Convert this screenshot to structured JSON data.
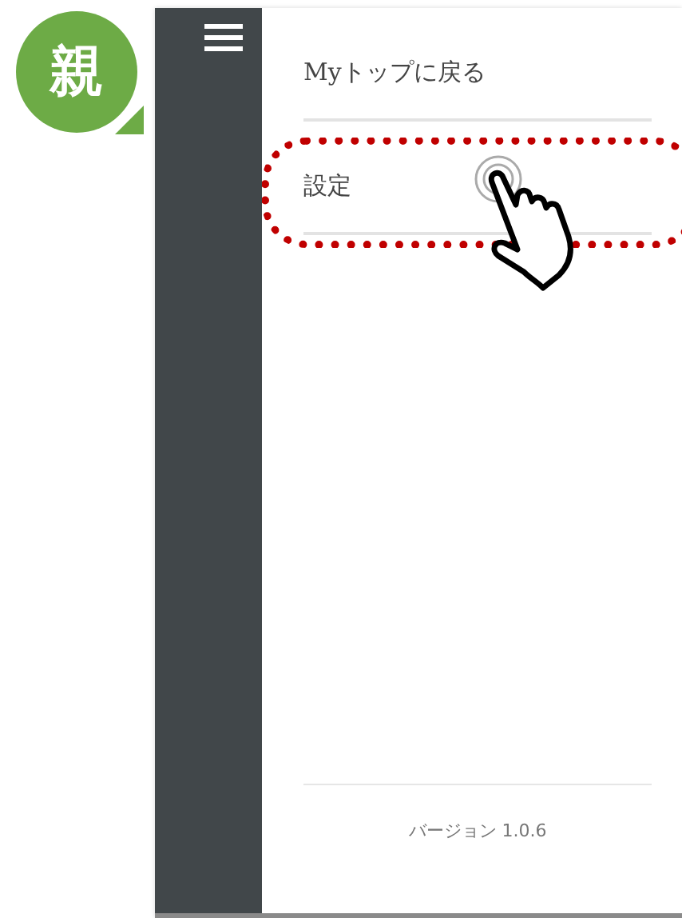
{
  "badge": {
    "label": "親"
  },
  "menu": {
    "items": [
      {
        "label": "Myトップに戻る",
        "highlighted": false
      },
      {
        "label": "設定",
        "highlighted": true
      }
    ]
  },
  "footer": {
    "version": "バージョン 1.0.6"
  }
}
